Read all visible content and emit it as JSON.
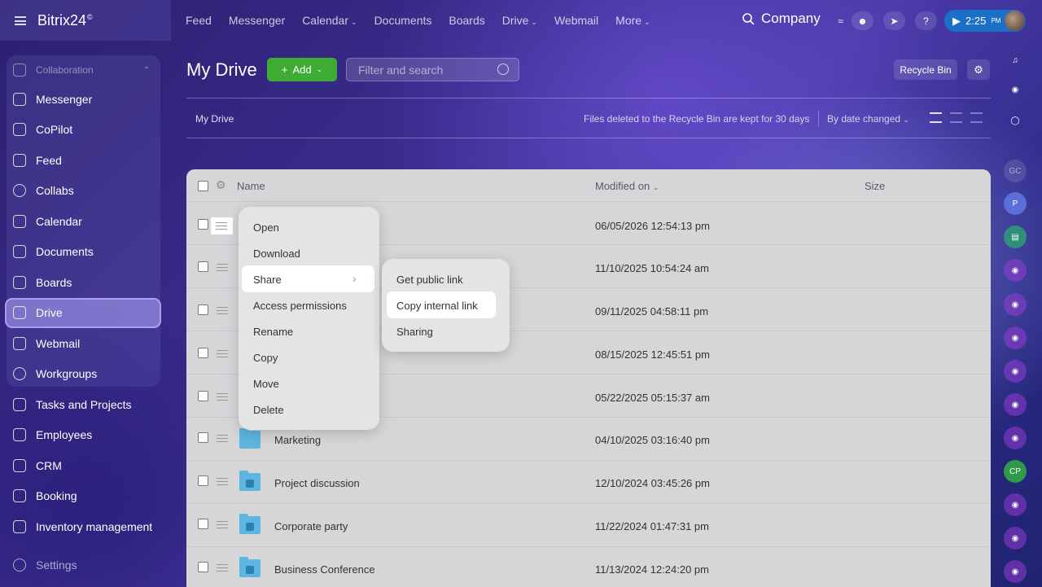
{
  "header": {
    "brand": "Bitrix24",
    "brand_mark": "©",
    "nav": [
      {
        "label": "Feed",
        "dropdown": false
      },
      {
        "label": "Messenger",
        "dropdown": false
      },
      {
        "label": "Calendar",
        "dropdown": true
      },
      {
        "label": "Documents",
        "dropdown": false
      },
      {
        "label": "Boards",
        "dropdown": false
      },
      {
        "label": "Drive",
        "dropdown": true
      },
      {
        "label": "Webmail",
        "dropdown": false
      },
      {
        "label": "More",
        "dropdown": true
      }
    ],
    "company": "Company",
    "time": "2:25",
    "ampm": "PM"
  },
  "sidebar": {
    "group_label": "Collaboration",
    "items": [
      {
        "label": "Messenger",
        "icon": "chat-icon"
      },
      {
        "label": "CoPilot",
        "icon": "copilot-icon"
      },
      {
        "label": "Feed",
        "icon": "feed-icon"
      },
      {
        "label": "Collabs",
        "icon": "collabs-icon"
      },
      {
        "label": "Calendar",
        "icon": "calendar-icon"
      },
      {
        "label": "Documents",
        "icon": "document-icon"
      },
      {
        "label": "Boards",
        "icon": "boards-icon"
      },
      {
        "label": "Drive",
        "icon": "drive-icon",
        "active": true
      },
      {
        "label": "Webmail",
        "icon": "mail-icon"
      },
      {
        "label": "Workgroups",
        "icon": "workgroups-icon"
      },
      {
        "label": "Tasks and Projects",
        "icon": "tasks-icon"
      },
      {
        "label": "Employees",
        "icon": "employees-icon"
      },
      {
        "label": "CRM",
        "icon": "crm-icon"
      },
      {
        "label": "Booking",
        "icon": "booking-icon"
      },
      {
        "label": "Inventory management",
        "icon": "inventory-icon"
      },
      {
        "label": "Settings",
        "icon": "settings-icon"
      }
    ]
  },
  "toolbar": {
    "title": "My Drive",
    "add_label": "Add",
    "search_placeholder": "Filter and search",
    "recycle_label": "Recycle Bin",
    "breadcrumb": "My Drive",
    "info": "Files deleted to the Recycle Bin are kept for 30 days",
    "sort_label": "By date changed"
  },
  "table": {
    "columns": [
      "Name",
      "Modified on",
      "Size"
    ],
    "rows": [
      {
        "name": "",
        "modified": "06/05/2026 12:54:13 pm",
        "folder": false
      },
      {
        "name": "",
        "modified": "11/10/2025 10:54:24 am",
        "folder": false
      },
      {
        "name": "",
        "modified": "09/11/2025 04:58:11 pm",
        "folder": false
      },
      {
        "name": "",
        "modified": "08/15/2025 12:45:51 pm",
        "folder": false
      },
      {
        "name": "",
        "modified": "05/22/2025 05:15:37 am",
        "folder": false
      },
      {
        "name": "Marketing",
        "modified": "04/10/2025 03:16:40 pm",
        "folder": true
      },
      {
        "name": "Project discussion",
        "modified": "12/10/2024 03:45:26 pm",
        "folder": true
      },
      {
        "name": "Corporate party",
        "modified": "11/22/2024 01:47:31 pm",
        "folder": true
      },
      {
        "name": "Business Conference",
        "modified": "11/13/2024 12:24:20 pm",
        "folder": true
      }
    ]
  },
  "context_menu": {
    "items": [
      "Open",
      "Download",
      "Share",
      "Access permissions",
      "Rename",
      "Copy",
      "Move",
      "Delete"
    ],
    "highlighted": "Share"
  },
  "submenu": {
    "items": [
      "Get public link",
      "Copy internal link",
      "Sharing"
    ],
    "highlighted": "Copy internal link"
  },
  "right_rail": {
    "labels": [
      "GC",
      "P",
      "CP"
    ]
  },
  "colors": {
    "accent_green": "#3eac34",
    "clock_blue": "#1c6fc7",
    "folder_blue": "#5cb6e0"
  }
}
